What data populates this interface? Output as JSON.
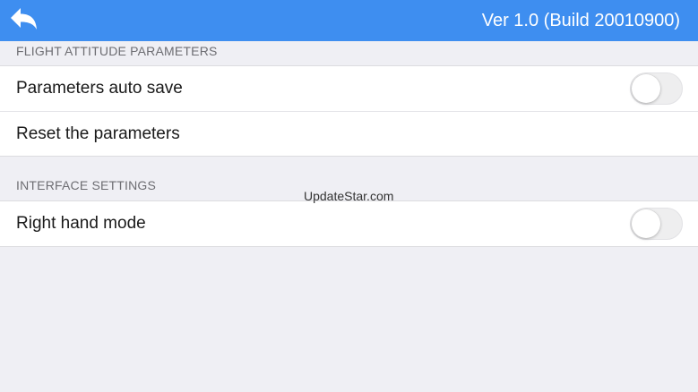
{
  "header": {
    "back_icon": "back-arrow-icon",
    "version_text": "Ver 1.0 (Build 20010900)",
    "background_color": "#3e8ef0"
  },
  "sections": [
    {
      "title": "FLIGHT ATTITUDE PARAMETERS",
      "rows": [
        {
          "label": "Parameters auto save",
          "toggle": false
        },
        {
          "label": "Reset the parameters"
        }
      ]
    },
    {
      "title": "INTERFACE SETTINGS",
      "rows": [
        {
          "label": "Right hand mode",
          "toggle": false
        }
      ]
    }
  ],
  "watermark": "UpdateStar.com"
}
